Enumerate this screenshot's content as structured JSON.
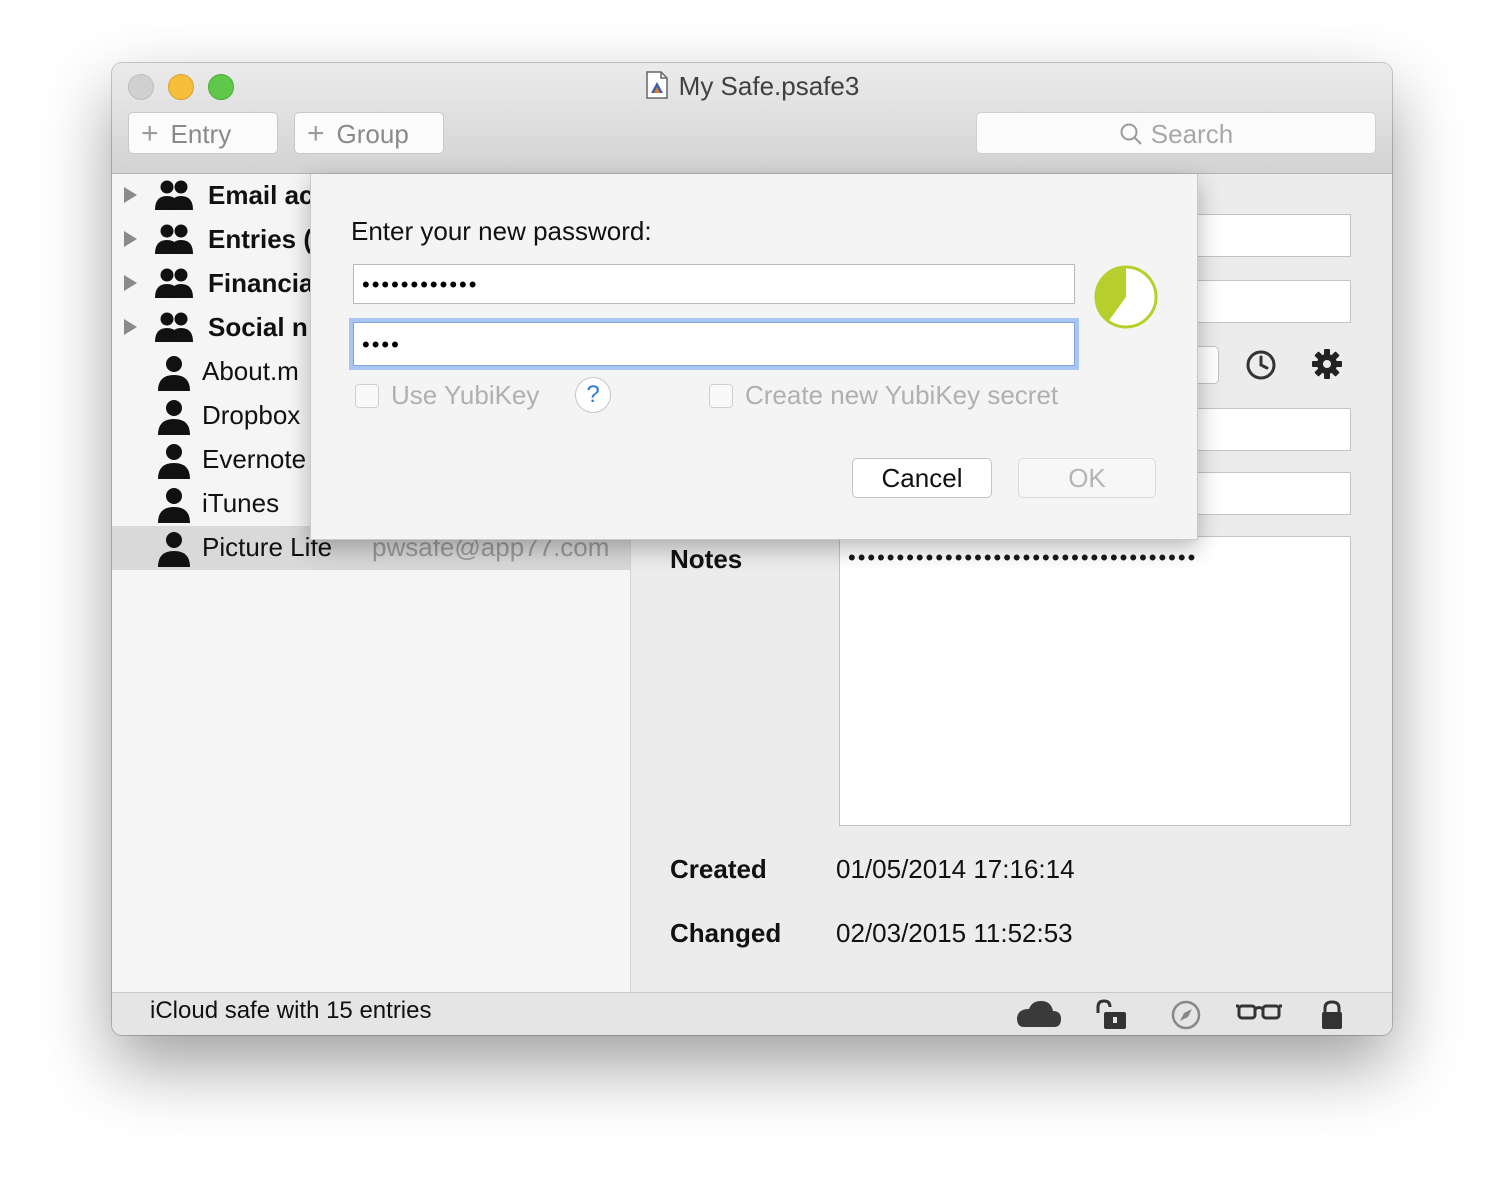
{
  "window": {
    "title": "My Safe.psafe3"
  },
  "toolbar": {
    "add_entry_label": "Entry",
    "add_group_label": "Group",
    "search_placeholder": "Search"
  },
  "sidebar": {
    "groups": [
      {
        "label": "Email ac"
      },
      {
        "label": "Entries ("
      },
      {
        "label": "Financia"
      },
      {
        "label": "Social n"
      }
    ],
    "entries": [
      {
        "label": "About.m",
        "user": ""
      },
      {
        "label": "Dropbox",
        "user": ""
      },
      {
        "label": "Evernote",
        "user": ""
      },
      {
        "label": "iTunes",
        "user": ""
      },
      {
        "label": "Picture Life",
        "user": "pwsafe@app77.com",
        "selected": true
      }
    ]
  },
  "detail": {
    "notes_label": "Notes",
    "notes_value": "••••••••••••••••••••••••••••••••••••",
    "created_label": "Created",
    "created_value": "01/05/2014 17:16:14",
    "changed_label": "Changed",
    "changed_value": "02/03/2015 11:52:53"
  },
  "statusbar": {
    "text": "iCloud safe with 15 entries",
    "icons": [
      "cloud-icon",
      "unlock-icon",
      "compass-icon",
      "glasses-icon",
      "lock-icon"
    ]
  },
  "dialog": {
    "prompt": "Enter your new password:",
    "password_value": "••••••••••••",
    "confirm_value": "••••",
    "strength_fraction": 0.4,
    "strength_color": "#b7cf2c",
    "use_yubikey_label": "Use YubiKey",
    "help_label": "?",
    "new_secret_label": "Create new YubiKey secret",
    "cancel_label": "Cancel",
    "ok_label": "OK"
  }
}
